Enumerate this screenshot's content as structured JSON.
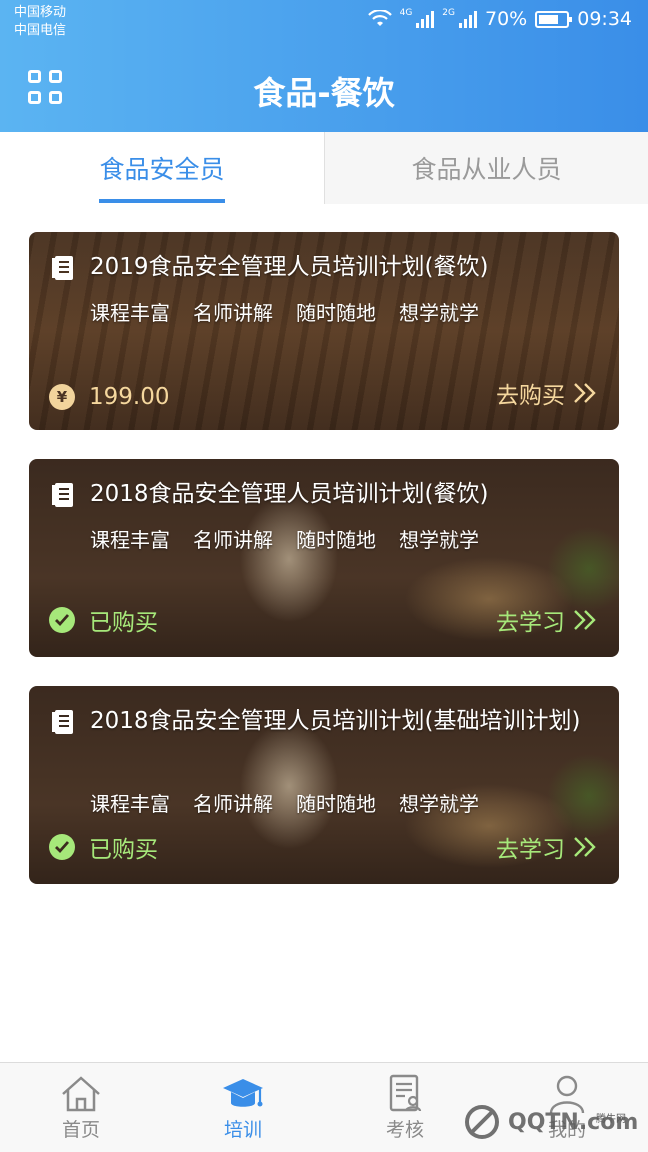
{
  "status": {
    "carrier1": "中国移动",
    "carrier2": "中国电信",
    "net1": "4G",
    "net2": "2G",
    "battery": "70%",
    "time": "09:34"
  },
  "header": {
    "title": "食品-餐饮"
  },
  "tabs": [
    {
      "label": "食品安全员",
      "active": true
    },
    {
      "label": "食品从业人员",
      "active": false
    }
  ],
  "cards": [
    {
      "title": "2019食品安全管理人员培训计划(餐饮)",
      "tags": [
        "课程丰富",
        "名师讲解",
        "随时随地",
        "想学就学"
      ],
      "price": "199.00",
      "action": "去购买"
    },
    {
      "title": "2018食品安全管理人员培训计划(餐饮)",
      "tags": [
        "课程丰富",
        "名师讲解",
        "随时随地",
        "想学就学"
      ],
      "status": "已购买",
      "action": "去学习"
    },
    {
      "title": "2018食品安全管理人员培训计划(基础培训计划)",
      "tags": [
        "课程丰富",
        "名师讲解",
        "随时随地",
        "想学就学"
      ],
      "status": "已购买",
      "action": "去学习"
    }
  ],
  "bottom_nav": [
    {
      "label": "首页",
      "icon": "home-icon"
    },
    {
      "label": "培训",
      "icon": "graduation-cap-icon",
      "active": true
    },
    {
      "label": "考核",
      "icon": "exam-icon"
    },
    {
      "label": "我的",
      "icon": "user-icon"
    }
  ],
  "watermark": {
    "text": "QQTN.com",
    "small": "腾牛网"
  },
  "colors": {
    "header_start": "#5bb4f2",
    "header_end": "#3a8ee8",
    "accent": "#3a8ee8",
    "price": "#f5d79e",
    "bought": "#a6e87a"
  }
}
